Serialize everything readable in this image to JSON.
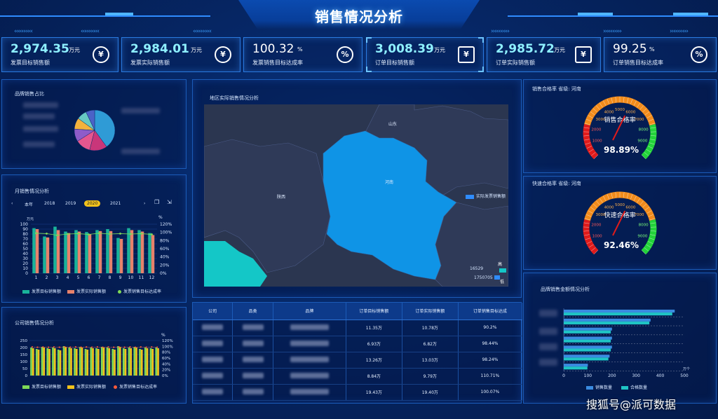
{
  "header": {
    "title": "销售情况分析"
  },
  "kpis": [
    {
      "value": "2,974.35",
      "unit": "万元",
      "label": "发票目标销售额",
      "icon": "money-bag-icon"
    },
    {
      "value": "2,984.01",
      "unit": "万元",
      "label": "发票实际销售额",
      "icon": "money-bag-icon"
    },
    {
      "value": "100.32",
      "unit": "%",
      "label": "发票销售目标达成率",
      "icon": "percent-icon"
    },
    {
      "value": "3,008.39",
      "unit": "万元",
      "label": "订单目标销售额",
      "icon": "yen-house-icon"
    },
    {
      "value": "2,985.72",
      "unit": "万元",
      "label": "订单实际销售额",
      "icon": "yen-house-icon"
    },
    {
      "value": "99.25",
      "unit": "%",
      "label": "订单销售目标达成率",
      "icon": "percent-icon"
    }
  ],
  "panels": {
    "pie_title": "品牌销售占比",
    "monthly_title": "月销售情况分析",
    "company_title": "公司销售情况分析",
    "map_title": "地区实际销售情况分析",
    "gauge1_header": "销售合格率   省级: 河南",
    "gauge2_header": "快速合格率   省级: 河南",
    "brand_bar_title": "品牌销售金额情况分析"
  },
  "monthly": {
    "years": [
      "本年",
      "2018",
      "2019",
      "2020",
      "2021"
    ],
    "active_year": "2020",
    "legend": [
      "发票目标销售额",
      "发票实际销售额",
      "发票销售目标达成率"
    ],
    "y_unit": "万元",
    "y2_unit": "%"
  },
  "company": {
    "legend": [
      "发票目标销售额",
      "发票实际销售额",
      "发票销售目标达成率"
    ],
    "y2_unit": "%"
  },
  "map": {
    "labels": {
      "henan": "河南",
      "shanxi": "陕西",
      "shandong": "山东"
    },
    "legend_label": "实际发票销售额",
    "range_high_label": "高",
    "range_high_value": "16529",
    "range_low_label": "低",
    "range_low_value": "1750705"
  },
  "gauges": [
    {
      "label": "销售合格率",
      "value": "98.89%"
    },
    {
      "label": "快速合格率",
      "value": "92.46%"
    }
  ],
  "brand_bar": {
    "legend": [
      "销售数量",
      "合格数量"
    ],
    "x_unit": "万个"
  },
  "table": {
    "headers": [
      "公司",
      "品类",
      "品牌",
      "订单目标销售额",
      "订单实际销售额",
      "订单销售目标达成"
    ],
    "rows": [
      [
        "11.35万",
        "10.78万",
        "90.2%"
      ],
      [
        "6.93万",
        "6.82万",
        "98.44%"
      ],
      [
        "13.26万",
        "13.03万",
        "98.24%"
      ],
      [
        "8.84万",
        "9.79万",
        "110.71%"
      ],
      [
        "19.43万",
        "19.40万",
        "100.07%"
      ]
    ]
  },
  "watermark": "搜狐号@派可数据",
  "chart_data": [
    {
      "type": "pie",
      "title": "品牌销售占比",
      "slices": [
        {
          "value": 40,
          "color": "#2f9bd6"
        },
        {
          "value": 14,
          "color": "#c9367a"
        },
        {
          "value": 12,
          "color": "#e5578f"
        },
        {
          "value": 10,
          "color": "#8e5cc9"
        },
        {
          "value": 9,
          "color": "#f4b23c"
        },
        {
          "value": 8,
          "color": "#67c9c3"
        },
        {
          "value": 7,
          "color": "#4b62c7"
        }
      ]
    },
    {
      "type": "bar",
      "title": "月销售情况分析",
      "categories": [
        "1",
        "2",
        "3",
        "4",
        "5",
        "6",
        "7",
        "8",
        "9",
        "10",
        "11",
        "12"
      ],
      "ylim": [
        0,
        100
      ],
      "y2lim": [
        0,
        120
      ],
      "yticks": [
        0,
        10,
        20,
        30,
        40,
        50,
        60,
        70,
        80,
        90,
        100
      ],
      "y2ticks": [
        "0%",
        "20%",
        "40%",
        "60%",
        "80%",
        "100%",
        "120%"
      ],
      "series": [
        {
          "name": "发票目标销售额",
          "color": "#19b39a",
          "values": [
            92,
            75,
            95,
            85,
            88,
            84,
            88,
            90,
            72,
            92,
            88,
            82
          ]
        },
        {
          "name": "发票实际销售额",
          "color": "#e7826b",
          "values": [
            90,
            73,
            88,
            82,
            85,
            80,
            86,
            86,
            70,
            88,
            85,
            78
          ]
        },
        {
          "name": "发票销售目标达成率",
          "color": "#7ed957",
          "type": "line",
          "values": [
            98,
            97,
            93,
            96,
            97,
            95,
            98,
            96,
            97,
            96,
            97,
            95
          ]
        }
      ]
    },
    {
      "type": "bar",
      "title": "公司销售情况分析",
      "ylim": [
        0,
        250
      ],
      "yticks": [
        0,
        50,
        100,
        150,
        200,
        250
      ],
      "y2ticks": [
        "0%",
        "20%",
        "40%",
        "60%",
        "80%",
        "100%",
        "120%"
      ],
      "series": [
        {
          "name": "发票目标销售额",
          "color": "#7ed957",
          "values": [
            200,
            190,
            205,
            195,
            200,
            185,
            210,
            200,
            195,
            205,
            190,
            200,
            195,
            205,
            200,
            190,
            210,
            195,
            200,
            205,
            190,
            200,
            195,
            200
          ]
        },
        {
          "name": "发票实际销售额",
          "color": "#f2c21b",
          "values": [
            195,
            185,
            200,
            190,
            195,
            180,
            205,
            195,
            190,
            200,
            185,
            195,
            190,
            200,
            195,
            185,
            205,
            190,
            195,
            200,
            185,
            195,
            190,
            195
          ]
        },
        {
          "name": "发票销售目标达成率",
          "color": "#ff5a3a",
          "type": "line",
          "values": [
            98,
            97,
            98,
            97,
            98,
            97,
            98,
            97,
            98,
            97,
            98,
            97,
            98,
            97,
            98,
            97,
            98,
            97,
            98,
            97,
            98,
            97,
            98,
            97
          ]
        }
      ]
    },
    {
      "type": "bar",
      "title": "品牌销售金额情况分析",
      "orientation": "horizontal",
      "xlim": [
        0,
        500
      ],
      "xticks": [
        0,
        100,
        200,
        300,
        400,
        500
      ],
      "series": [
        {
          "name": "销售数量",
          "color": "#3a8be0",
          "values": [
            460,
            360,
            200,
            200,
            200,
            190,
            100
          ]
        },
        {
          "name": "合格数量",
          "color": "#1fc4c4",
          "values": [
            450,
            355,
            195,
            195,
            195,
            185,
            98
          ]
        }
      ]
    },
    {
      "type": "gauge",
      "title": "销售合格率",
      "value": 98.89,
      "ticks": [
        "1000",
        "2000",
        "3000",
        "4000",
        "5000",
        "6000",
        "7000",
        "8000",
        "9000"
      ]
    },
    {
      "type": "gauge",
      "title": "快速合格率",
      "value": 92.46,
      "ticks": [
        "1000",
        "2000",
        "3000",
        "4000",
        "5000",
        "6000",
        "7000",
        "8000",
        "9000"
      ]
    }
  ]
}
